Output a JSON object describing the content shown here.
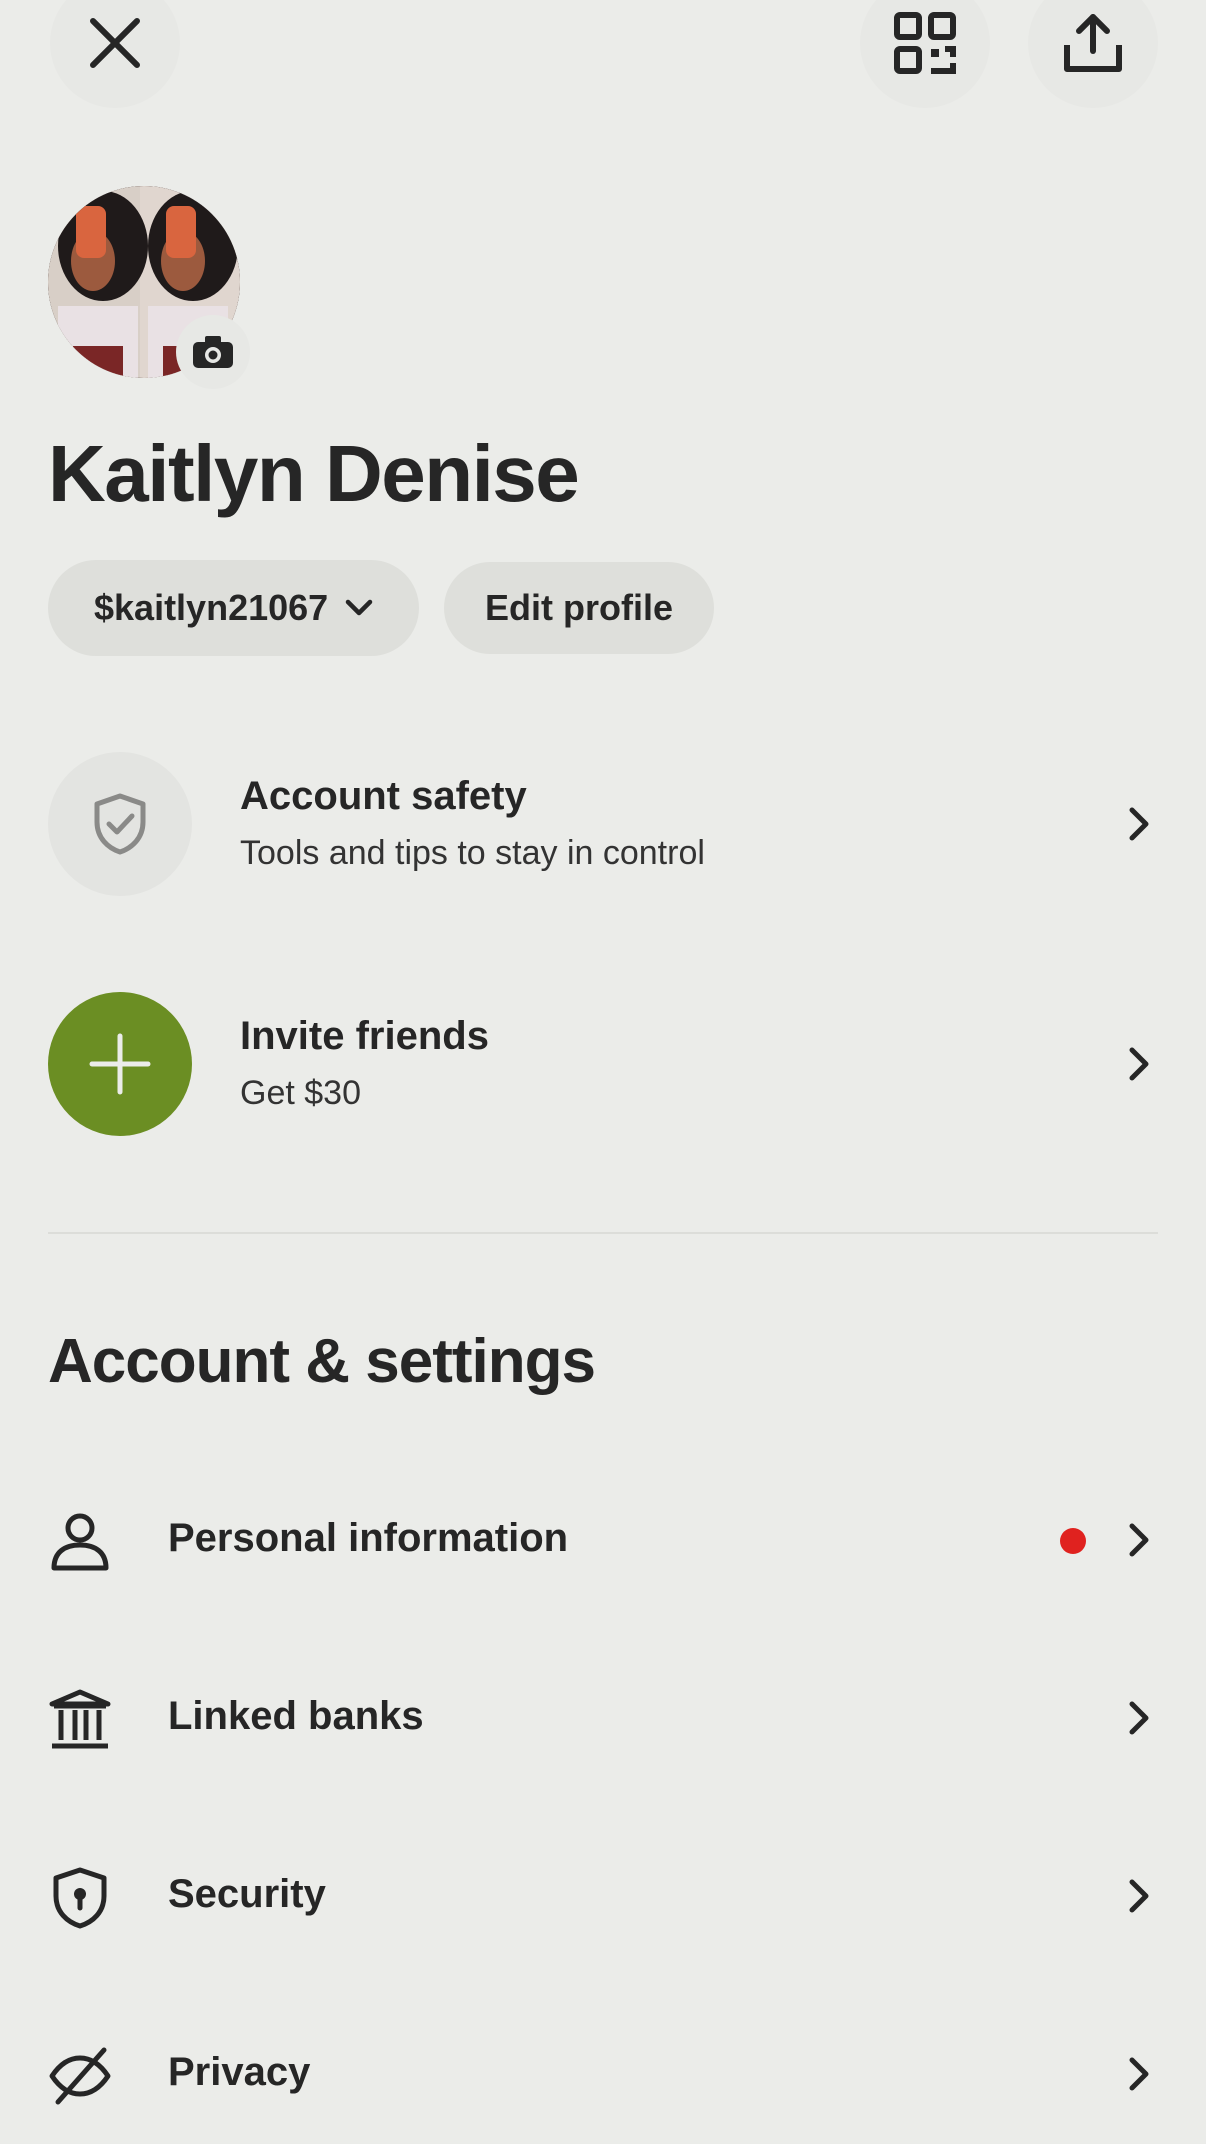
{
  "header": {
    "close_icon": "close-icon",
    "qr_icon": "qr-code-icon",
    "share_icon": "share-icon"
  },
  "profile": {
    "name": "Kaitlyn Denise",
    "cashtag": "$kaitlyn21067",
    "edit_label": "Edit profile",
    "camera_icon": "camera-icon"
  },
  "cards": [
    {
      "title": "Account safety",
      "subtitle": "Tools and tips to stay in control",
      "icon": "shield-check-icon"
    },
    {
      "title": "Invite friends",
      "subtitle": "Get $30",
      "icon": "plus-icon"
    }
  ],
  "settings": {
    "title": "Account & settings",
    "items": [
      {
        "label": "Personal information",
        "icon": "person-icon",
        "has_alert": true
      },
      {
        "label": "Linked banks",
        "icon": "bank-icon",
        "has_alert": false
      },
      {
        "label": "Security",
        "icon": "shield-lock-icon",
        "has_alert": false
      },
      {
        "label": "Privacy",
        "icon": "eye-slash-icon",
        "has_alert": false
      }
    ]
  },
  "colors": {
    "background": "#EBECE9",
    "text": "#262626",
    "accent_green": "#6B8E23",
    "alert_red": "#E0221F",
    "pill_bg": "#DEDFDB"
  }
}
